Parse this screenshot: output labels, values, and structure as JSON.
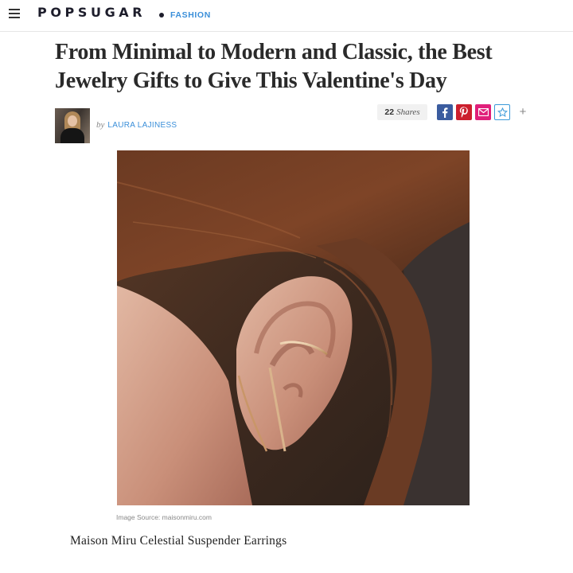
{
  "header": {
    "logo_text": "POPSUGAR",
    "section_label": "FASHION",
    "menu_icon": "hamburger-icon"
  },
  "article": {
    "title": "From Minimal to Modern and Classic, the Best Jewelry Gifts to Give This Valentine's Day",
    "byline_prefix": "by",
    "author": "LAURA LAJINESS",
    "share_count": "22",
    "share_label": "Shares",
    "image_source": "Image Source: maisonmiru.com",
    "product_name": "Maison Miru Celestial Suspender Earrings"
  },
  "share_buttons": [
    {
      "name": "facebook",
      "icon": "facebook-icon",
      "color": "#3b5c9f"
    },
    {
      "name": "pinterest",
      "icon": "pinterest-icon",
      "color": "#cc1f2d"
    },
    {
      "name": "email",
      "icon": "mail-icon",
      "color": "#e01f7a"
    },
    {
      "name": "favorite",
      "icon": "star-icon",
      "color": "#3b9ad9"
    },
    {
      "name": "more",
      "icon": "plus-icon",
      "color": "#888888"
    }
  ],
  "colors": {
    "brand": "#1d1d2b",
    "accent": "#3b8fd9"
  }
}
